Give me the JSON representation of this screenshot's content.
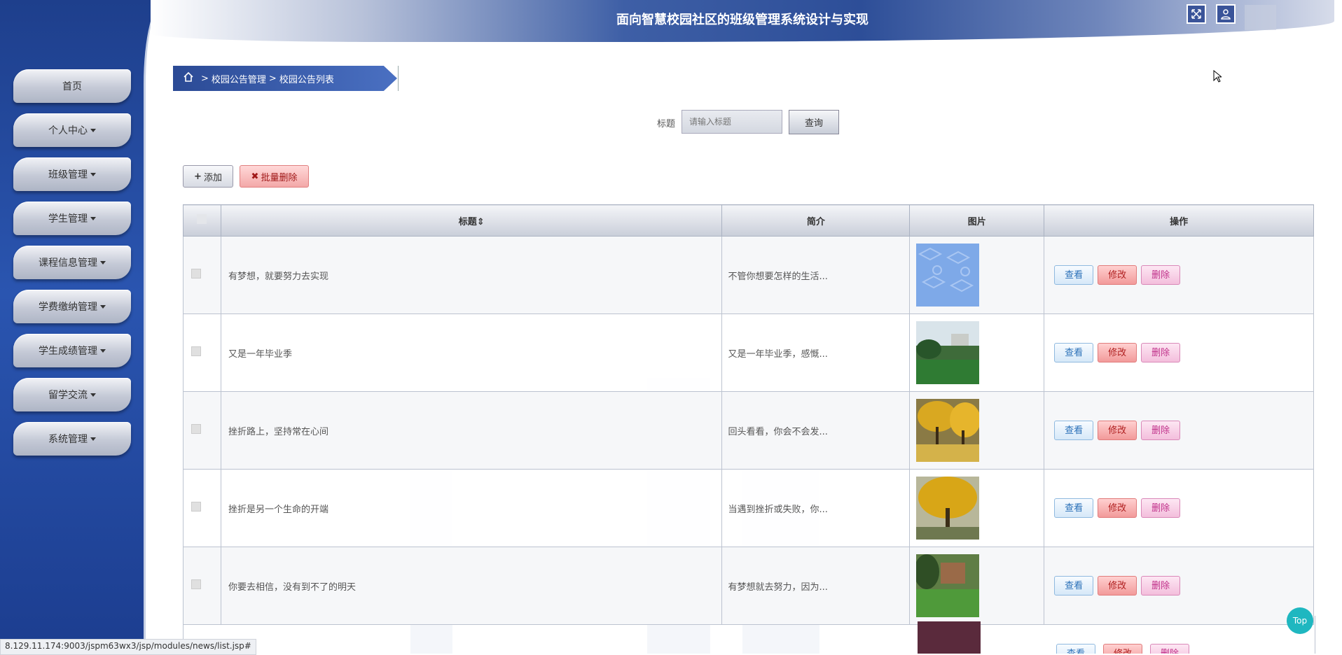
{
  "header": {
    "title": "面向智慧校园社区的班级管理系统设计与实现"
  },
  "sidebar": {
    "items": [
      {
        "label": "首页",
        "has_caret": false
      },
      {
        "label": "个人中心",
        "has_caret": true
      },
      {
        "label": "班级管理",
        "has_caret": true
      },
      {
        "label": "学生管理",
        "has_caret": true
      },
      {
        "label": "课程信息管理",
        "has_caret": true
      },
      {
        "label": "学费缴纳管理",
        "has_caret": true
      },
      {
        "label": "学生成绩管理",
        "has_caret": true
      },
      {
        "label": "留学交流",
        "has_caret": true
      },
      {
        "label": "系统管理",
        "has_caret": true
      }
    ]
  },
  "breadcrumb": {
    "level1": "校园公告管理",
    "level2": "校园公告列表",
    "separator": ">"
  },
  "search": {
    "label": "标题",
    "placeholder": "请输入标题",
    "button": "查询"
  },
  "actions": {
    "add": "添加",
    "batch_delete": "批量删除"
  },
  "table": {
    "headers": {
      "title": "标题",
      "intro": "简介",
      "image": "图片",
      "ops": "操作"
    },
    "op_labels": {
      "view": "查看",
      "edit": "修改",
      "delete": "删除"
    },
    "rows": [
      {
        "title": "有梦想，就要努力去实现",
        "intro": "不管你想要怎样的生活...",
        "image": "thumb-blue-pattern"
      },
      {
        "title": "又是一年毕业季",
        "intro": "又是一年毕业季，感慨...",
        "image": "thumb-campus-lawn"
      },
      {
        "title": "挫折路上，坚持常在心间",
        "intro": "回头看看，你会不会发...",
        "image": "thumb-ginkgo-path"
      },
      {
        "title": "挫折是另一个生命的开端",
        "intro": "当遇到挫折或失败，你...",
        "image": "thumb-ginkgo-tree"
      },
      {
        "title": "你要去相信，没有到不了的明天",
        "intro": "有梦想就去努力，因为...",
        "image": "thumb-building-lawn"
      }
    ]
  },
  "status_bar": {
    "url": "8.129.11.174:9003/jspm63wx3/jsp/modules/news/list.jsp#"
  },
  "top_button": {
    "label": "Top"
  },
  "colors": {
    "sidebar": "#2a55b0",
    "view": "#2a70b8",
    "edit": "#b02020",
    "delete": "#c0308a",
    "top": "#1fb7c0"
  }
}
